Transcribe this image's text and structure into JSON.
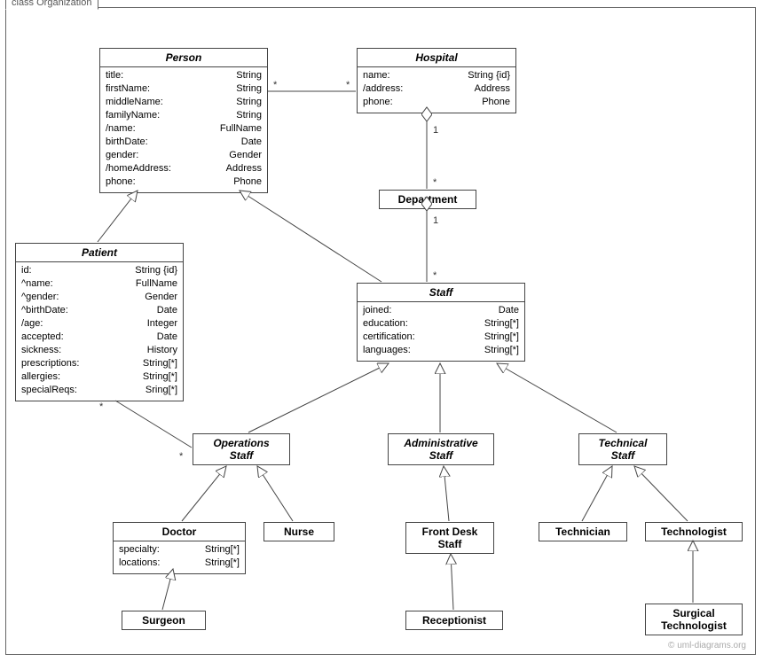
{
  "frame_label": "class Organization",
  "watermark": "© uml-diagrams.org",
  "classes": {
    "person": {
      "name": "Person",
      "attrs": [
        {
          "k": "title:",
          "v": "String"
        },
        {
          "k": "firstName:",
          "v": "String"
        },
        {
          "k": "middleName:",
          "v": "String"
        },
        {
          "k": "familyName:",
          "v": "String"
        },
        {
          "k": "/name:",
          "v": "FullName"
        },
        {
          "k": "birthDate:",
          "v": "Date"
        },
        {
          "k": "gender:",
          "v": "Gender"
        },
        {
          "k": "/homeAddress:",
          "v": "Address"
        },
        {
          "k": "phone:",
          "v": "Phone"
        }
      ]
    },
    "hospital": {
      "name": "Hospital",
      "attrs": [
        {
          "k": "name:",
          "v": "String {id}"
        },
        {
          "k": "/address:",
          "v": "Address"
        },
        {
          "k": "phone:",
          "v": "Phone"
        }
      ]
    },
    "patient": {
      "name": "Patient",
      "attrs": [
        {
          "k": "id:",
          "v": "String {id}"
        },
        {
          "k": "^name:",
          "v": "FullName"
        },
        {
          "k": "^gender:",
          "v": "Gender"
        },
        {
          "k": "^birthDate:",
          "v": "Date"
        },
        {
          "k": "/age:",
          "v": "Integer"
        },
        {
          "k": "accepted:",
          "v": "Date"
        },
        {
          "k": "sickness:",
          "v": "History"
        },
        {
          "k": "prescriptions:",
          "v": "String[*]"
        },
        {
          "k": "allergies:",
          "v": "String[*]"
        },
        {
          "k": "specialReqs:",
          "v": "Sring[*]"
        }
      ]
    },
    "department": {
      "name": "Department"
    },
    "staff": {
      "name": "Staff",
      "attrs": [
        {
          "k": "joined:",
          "v": "Date"
        },
        {
          "k": "education:",
          "v": "String[*]"
        },
        {
          "k": "certification:",
          "v": "String[*]"
        },
        {
          "k": "languages:",
          "v": "String[*]"
        }
      ]
    },
    "opstaff": {
      "name": "Operations",
      "name2": "Staff"
    },
    "adminstaff": {
      "name": "Administrative",
      "name2": "Staff"
    },
    "techstaff": {
      "name": "Technical",
      "name2": "Staff"
    },
    "doctor": {
      "name": "Doctor",
      "attrs": [
        {
          "k": "specialty:",
          "v": "String[*]"
        },
        {
          "k": "locations:",
          "v": "String[*]"
        }
      ]
    },
    "nurse": {
      "name": "Nurse"
    },
    "frontdesk": {
      "name": "Front Desk",
      "name2": "Staff"
    },
    "technician": {
      "name": "Technician"
    },
    "technologist": {
      "name": "Technologist"
    },
    "surgeon": {
      "name": "Surgeon"
    },
    "receptionist": {
      "name": "Receptionist"
    },
    "surgtech": {
      "name": "Surgical",
      "name2": "Technologist"
    }
  },
  "mults": {
    "person_hosp_l": "*",
    "person_hosp_r": "*",
    "hosp_dept_top": "1",
    "hosp_dept_bot": "*",
    "dept_staff_top": "1",
    "dept_staff_bot": "*",
    "patient_ops_l": "*",
    "patient_ops_r": "*"
  }
}
